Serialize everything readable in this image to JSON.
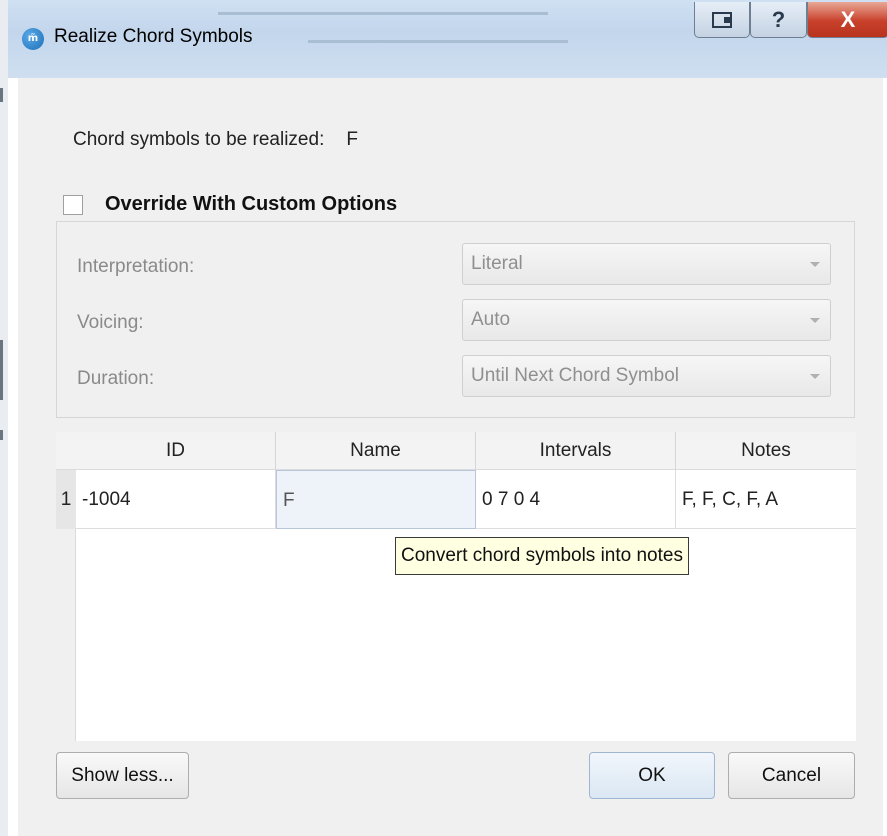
{
  "window": {
    "title": "Realize Chord Symbols",
    "app_icon_text": "m̃",
    "caption_buttons": {
      "help": "?",
      "close": "X"
    }
  },
  "summary": {
    "label": "Chord symbols to be realized:",
    "value": "F"
  },
  "override": {
    "label": "Override With Custom Options",
    "checked": false
  },
  "options": {
    "interpretation": {
      "label": "Interpretation:",
      "value": "Literal"
    },
    "voicing": {
      "label": "Voicing:",
      "value": "Auto"
    },
    "duration": {
      "label": "Duration:",
      "value": "Until Next Chord Symbol"
    }
  },
  "table": {
    "columns": [
      "ID",
      "Name",
      "Intervals",
      "Notes"
    ],
    "rows": [
      {
        "num": "1",
        "id": "-1004",
        "name": "F",
        "intervals": "0 7 0 4",
        "notes": "F, F, C, F, A"
      }
    ]
  },
  "tooltip": "Convert chord symbols into notes",
  "buttons": {
    "show_less": "Show less...",
    "ok": "OK",
    "cancel": "Cancel"
  }
}
